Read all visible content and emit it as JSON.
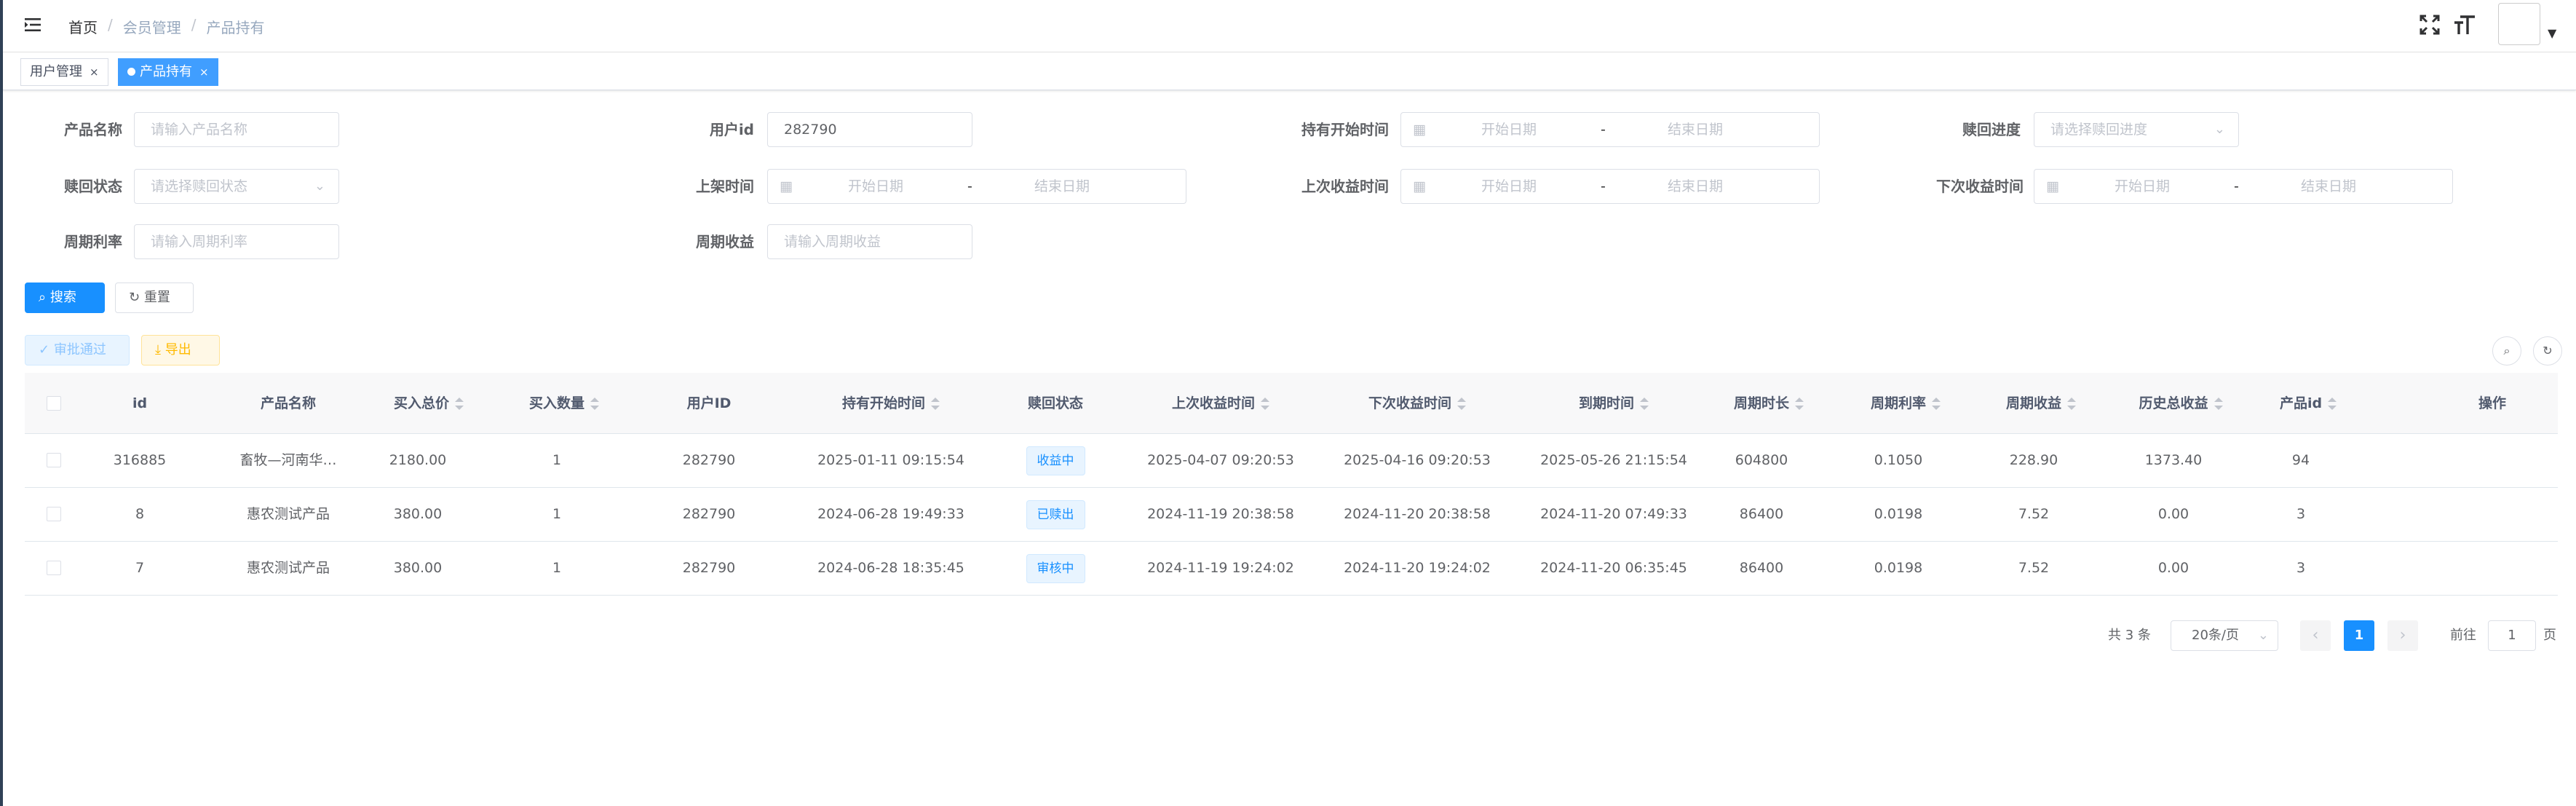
{
  "breadcrumb": {
    "home": "首页",
    "sep": "/",
    "level1": "会员管理",
    "level2": "产品持有"
  },
  "tabs": [
    {
      "label": "用户管理",
      "close": "×"
    },
    {
      "label": "产品持有",
      "close": "×"
    }
  ],
  "form": {
    "product_name": {
      "label": "产品名称",
      "placeholder": "请输入产品名称"
    },
    "user_id": {
      "label": "用户id",
      "value": "282790"
    },
    "hold_start": {
      "label": "持有开始时间",
      "start": "开始日期",
      "dash": "-",
      "end": "结束日期"
    },
    "redeem_progress": {
      "label": "赎回进度",
      "placeholder": "请选择赎回进度"
    },
    "redeem_status": {
      "label": "赎回状态",
      "placeholder": "请选择赎回状态"
    },
    "listing_time": {
      "label": "上架时间",
      "start": "开始日期",
      "dash": "-",
      "end": "结束日期"
    },
    "last_income_time": {
      "label": "上次收益时间",
      "start": "开始日期",
      "dash": "-",
      "end": "结束日期"
    },
    "next_income_time": {
      "label": "下次收益时间",
      "start": "开始日期",
      "dash": "-",
      "end": "结束日期"
    },
    "period_rate": {
      "label": "周期利率",
      "placeholder": "请输入周期利率"
    },
    "period_income": {
      "label": "周期收益",
      "placeholder": "请输入周期收益"
    },
    "search_button": "搜索",
    "reset_button": "重置"
  },
  "toolbar": {
    "approve_button": "审批通过",
    "export_button": "导出"
  },
  "table": {
    "headers": {
      "id": "id",
      "product_name": "产品名称",
      "buy_total": "买入总价",
      "buy_qty": "买入数量",
      "user_id": "用户ID",
      "hold_start": "持有开始时间",
      "redeem_status": "赎回状态",
      "last_income": "上次收益时间",
      "next_income": "下次收益时间",
      "expire": "到期时间",
      "period_len": "周期时长",
      "period_rate": "周期利率",
      "period_income": "周期收益",
      "history_income": "历史总收益",
      "product_id": "产品id",
      "actions": "操作"
    },
    "rows": [
      {
        "id": "316885",
        "product_name": "畜牧—河南华…",
        "buy_total": "2180.00",
        "buy_qty": "1",
        "user_id": "282790",
        "hold_start": "2025-01-11 09:15:54",
        "redeem_status": "收益中",
        "last_income": "2025-04-07 09:20:53",
        "next_income": "2025-04-16 09:20:53",
        "expire": "2025-05-26 21:15:54",
        "period_len": "604800",
        "period_rate": "0.1050",
        "period_income": "228.90",
        "history_income": "1373.40",
        "product_id": "94"
      },
      {
        "id": "8",
        "product_name": "惠农测试产品",
        "buy_total": "380.00",
        "buy_qty": "1",
        "user_id": "282790",
        "hold_start": "2024-06-28 19:49:33",
        "redeem_status": "已赎出",
        "last_income": "2024-11-19 20:38:58",
        "next_income": "2024-11-20 20:38:58",
        "expire": "2024-11-20 07:49:33",
        "period_len": "86400",
        "period_rate": "0.0198",
        "period_income": "7.52",
        "history_income": "0.00",
        "product_id": "3"
      },
      {
        "id": "7",
        "product_name": "惠农测试产品",
        "buy_total": "380.00",
        "buy_qty": "1",
        "user_id": "282790",
        "hold_start": "2024-06-28 18:35:45",
        "redeem_status": "审核中",
        "last_income": "2024-11-19 19:24:02",
        "next_income": "2024-11-20 19:24:02",
        "expire": "2024-11-20 06:35:45",
        "period_len": "86400",
        "period_rate": "0.0198",
        "period_income": "7.52",
        "history_income": "0.00",
        "product_id": "3"
      }
    ]
  },
  "pagination": {
    "total": "共 3 条",
    "page_size": "20条/页",
    "prev": "‹",
    "current": "1",
    "next": "›",
    "goto_label": "前往",
    "goto_value": "1",
    "page_suffix": "页"
  },
  "colors": {
    "primary": "#1890ff",
    "warning": "#ffba00",
    "sidebar": "#304156"
  }
}
